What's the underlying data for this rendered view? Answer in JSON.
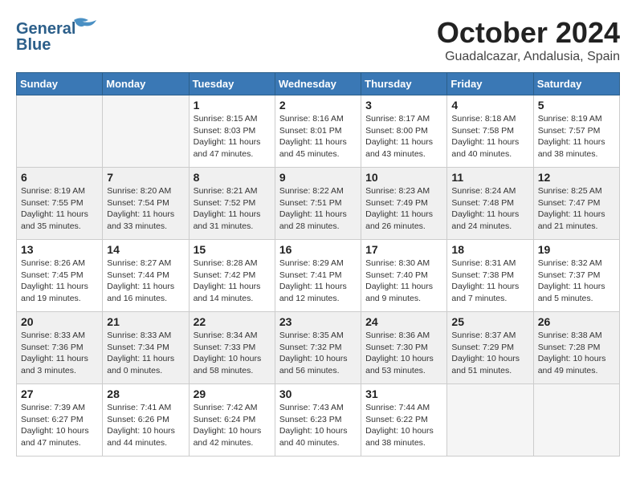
{
  "logo": {
    "line1": "General",
    "line2": "Blue"
  },
  "title": "October 2024",
  "subtitle": "Guadalcazar, Andalusia, Spain",
  "weekdays": [
    "Sunday",
    "Monday",
    "Tuesday",
    "Wednesday",
    "Thursday",
    "Friday",
    "Saturday"
  ],
  "weeks": [
    [
      {
        "day": "",
        "info": ""
      },
      {
        "day": "",
        "info": ""
      },
      {
        "day": "1",
        "info": "Sunrise: 8:15 AM\nSunset: 8:03 PM\nDaylight: 11 hours and 47 minutes."
      },
      {
        "day": "2",
        "info": "Sunrise: 8:16 AM\nSunset: 8:01 PM\nDaylight: 11 hours and 45 minutes."
      },
      {
        "day": "3",
        "info": "Sunrise: 8:17 AM\nSunset: 8:00 PM\nDaylight: 11 hours and 43 minutes."
      },
      {
        "day": "4",
        "info": "Sunrise: 8:18 AM\nSunset: 7:58 PM\nDaylight: 11 hours and 40 minutes."
      },
      {
        "day": "5",
        "info": "Sunrise: 8:19 AM\nSunset: 7:57 PM\nDaylight: 11 hours and 38 minutes."
      }
    ],
    [
      {
        "day": "6",
        "info": "Sunrise: 8:19 AM\nSunset: 7:55 PM\nDaylight: 11 hours and 35 minutes."
      },
      {
        "day": "7",
        "info": "Sunrise: 8:20 AM\nSunset: 7:54 PM\nDaylight: 11 hours and 33 minutes."
      },
      {
        "day": "8",
        "info": "Sunrise: 8:21 AM\nSunset: 7:52 PM\nDaylight: 11 hours and 31 minutes."
      },
      {
        "day": "9",
        "info": "Sunrise: 8:22 AM\nSunset: 7:51 PM\nDaylight: 11 hours and 28 minutes."
      },
      {
        "day": "10",
        "info": "Sunrise: 8:23 AM\nSunset: 7:49 PM\nDaylight: 11 hours and 26 minutes."
      },
      {
        "day": "11",
        "info": "Sunrise: 8:24 AM\nSunset: 7:48 PM\nDaylight: 11 hours and 24 minutes."
      },
      {
        "day": "12",
        "info": "Sunrise: 8:25 AM\nSunset: 7:47 PM\nDaylight: 11 hours and 21 minutes."
      }
    ],
    [
      {
        "day": "13",
        "info": "Sunrise: 8:26 AM\nSunset: 7:45 PM\nDaylight: 11 hours and 19 minutes."
      },
      {
        "day": "14",
        "info": "Sunrise: 8:27 AM\nSunset: 7:44 PM\nDaylight: 11 hours and 16 minutes."
      },
      {
        "day": "15",
        "info": "Sunrise: 8:28 AM\nSunset: 7:42 PM\nDaylight: 11 hours and 14 minutes."
      },
      {
        "day": "16",
        "info": "Sunrise: 8:29 AM\nSunset: 7:41 PM\nDaylight: 11 hours and 12 minutes."
      },
      {
        "day": "17",
        "info": "Sunrise: 8:30 AM\nSunset: 7:40 PM\nDaylight: 11 hours and 9 minutes."
      },
      {
        "day": "18",
        "info": "Sunrise: 8:31 AM\nSunset: 7:38 PM\nDaylight: 11 hours and 7 minutes."
      },
      {
        "day": "19",
        "info": "Sunrise: 8:32 AM\nSunset: 7:37 PM\nDaylight: 11 hours and 5 minutes."
      }
    ],
    [
      {
        "day": "20",
        "info": "Sunrise: 8:33 AM\nSunset: 7:36 PM\nDaylight: 11 hours and 3 minutes."
      },
      {
        "day": "21",
        "info": "Sunrise: 8:33 AM\nSunset: 7:34 PM\nDaylight: 11 hours and 0 minutes."
      },
      {
        "day": "22",
        "info": "Sunrise: 8:34 AM\nSunset: 7:33 PM\nDaylight: 10 hours and 58 minutes."
      },
      {
        "day": "23",
        "info": "Sunrise: 8:35 AM\nSunset: 7:32 PM\nDaylight: 10 hours and 56 minutes."
      },
      {
        "day": "24",
        "info": "Sunrise: 8:36 AM\nSunset: 7:30 PM\nDaylight: 10 hours and 53 minutes."
      },
      {
        "day": "25",
        "info": "Sunrise: 8:37 AM\nSunset: 7:29 PM\nDaylight: 10 hours and 51 minutes."
      },
      {
        "day": "26",
        "info": "Sunrise: 8:38 AM\nSunset: 7:28 PM\nDaylight: 10 hours and 49 minutes."
      }
    ],
    [
      {
        "day": "27",
        "info": "Sunrise: 7:39 AM\nSunset: 6:27 PM\nDaylight: 10 hours and 47 minutes."
      },
      {
        "day": "28",
        "info": "Sunrise: 7:41 AM\nSunset: 6:26 PM\nDaylight: 10 hours and 44 minutes."
      },
      {
        "day": "29",
        "info": "Sunrise: 7:42 AM\nSunset: 6:24 PM\nDaylight: 10 hours and 42 minutes."
      },
      {
        "day": "30",
        "info": "Sunrise: 7:43 AM\nSunset: 6:23 PM\nDaylight: 10 hours and 40 minutes."
      },
      {
        "day": "31",
        "info": "Sunrise: 7:44 AM\nSunset: 6:22 PM\nDaylight: 10 hours and 38 minutes."
      },
      {
        "day": "",
        "info": ""
      },
      {
        "day": "",
        "info": ""
      }
    ]
  ]
}
